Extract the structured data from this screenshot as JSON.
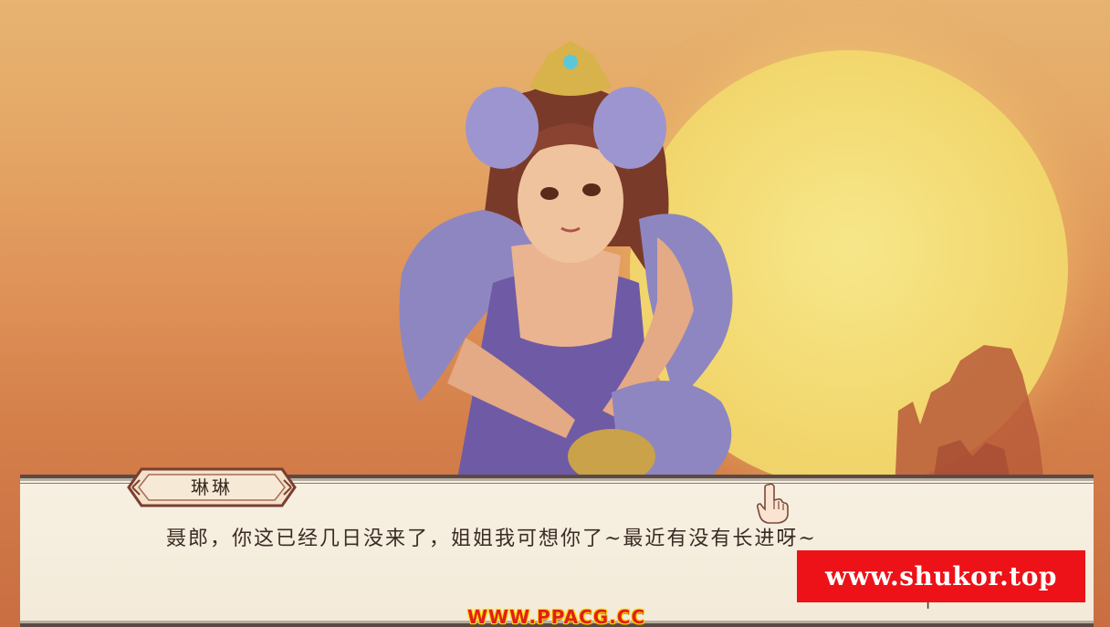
{
  "scene": {
    "sky_top_color": "#e7b370",
    "sky_bottom_color": "#c96e42",
    "sun_color": "#f2d86f",
    "sun_icon": "sun",
    "rock_icon": "rock-silhouette",
    "character_icon": "character-portrait"
  },
  "dialog": {
    "speaker_name": "琳琳",
    "text": "聂郎，你这已经几日没来了，姐姐我可想你了~最近有没有长进呀~",
    "next_icon": "pointing-hand-icon",
    "next_hint": "下一"
  },
  "watermarks": {
    "bottom": "WWW.PPACG.CC",
    "box": "www.shukor.top",
    "box_color": "#ec1218"
  }
}
